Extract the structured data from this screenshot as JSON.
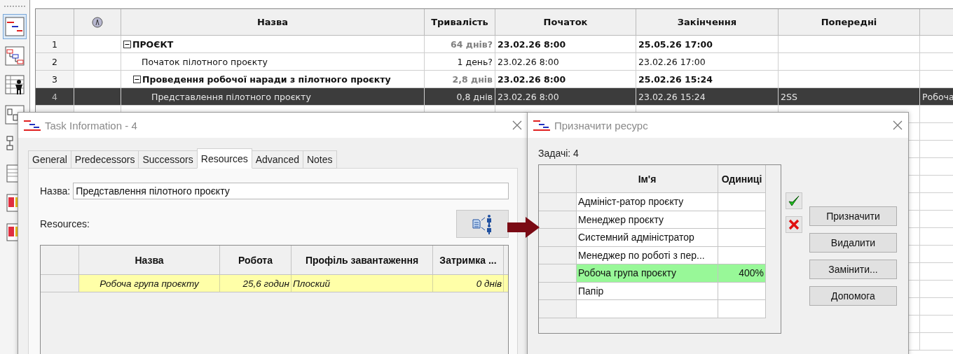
{
  "grid": {
    "columns": [
      "Назва",
      "Тривалість",
      "Початок",
      "Закінчення",
      "Попередні"
    ],
    "rows": [
      {
        "kind": "summary",
        "number": "1",
        "name": "ПРОЄКТ",
        "duration": "64 днів?",
        "start": "23.02.26 8:00",
        "finish": "25.05.26 17:00",
        "expanded": true,
        "selected": false,
        "children": [
          {
            "kind": "task",
            "number": "2",
            "name": "Початок пілотного проєкту",
            "duration": "1 день?",
            "start": "23.02.26 8:00",
            "finish": "23.02.26 17:00",
            "selected": false
          },
          {
            "kind": "summary",
            "number": "3",
            "name": "Проведення робочої наради з пілотного проєкту",
            "duration": "2,8 днів",
            "start": "23.02.26 8:00",
            "finish": "25.02.26 15:24",
            "expanded": true,
            "selected": false,
            "children": [
              {
                "kind": "task",
                "number": "4",
                "name": "Представлення пілотного проєкту",
                "duration": "0,8 днів",
                "start": "23.02.26 8:00",
                "finish": "23.02.26 15:24",
                "predecessors": "2SS",
                "column_8": "Робоча",
                "selected": true
              }
            ]
          }
        ]
      }
    ]
  },
  "task_dialog": {
    "title": "Task Information - 4",
    "tabs": [
      {
        "label": "General",
        "selected": false
      },
      {
        "label": "Predecessors",
        "selected": false
      },
      {
        "label": "Successors",
        "selected": false
      },
      {
        "label": "Resources",
        "selected": true
      },
      {
        "label": "Advanced",
        "selected": false
      },
      {
        "label": "Notes",
        "selected": false
      }
    ],
    "name_label": "Назва:",
    "name_value": "Представлення пілотного проєкту",
    "resources_label": "Resources:",
    "table": {
      "columns": [
        "Назва",
        "Робота",
        "Профіль завантаження",
        "Затримка ..."
      ],
      "rows": [
        {
          "name": "Робоча група проєкту",
          "work": "25,6 годин",
          "profile": "Плоский",
          "delay": "0 днів"
        }
      ]
    }
  },
  "assign_dialog": {
    "title": "Призначити ресурс",
    "tasks_label": "Задачі: 4",
    "table": {
      "columns": [
        "Ім'я",
        "Одиниці"
      ],
      "rows": [
        {
          "name": "Адмініст-ратор проєкту",
          "selected": false
        },
        {
          "name": "Менеджер проєкту",
          "selected": false
        },
        {
          "name": "Системний адміністратор",
          "selected": false
        },
        {
          "name": "Менеджер по роботі з пер...",
          "selected": false
        },
        {
          "name": "Робоча група проєкту",
          "units": "400%",
          "selected": true
        },
        {
          "name": "Папір",
          "selected": false
        }
      ]
    },
    "buttons": [
      "Призначити",
      "Видалити",
      "Замінити...",
      "Допомога"
    ]
  }
}
